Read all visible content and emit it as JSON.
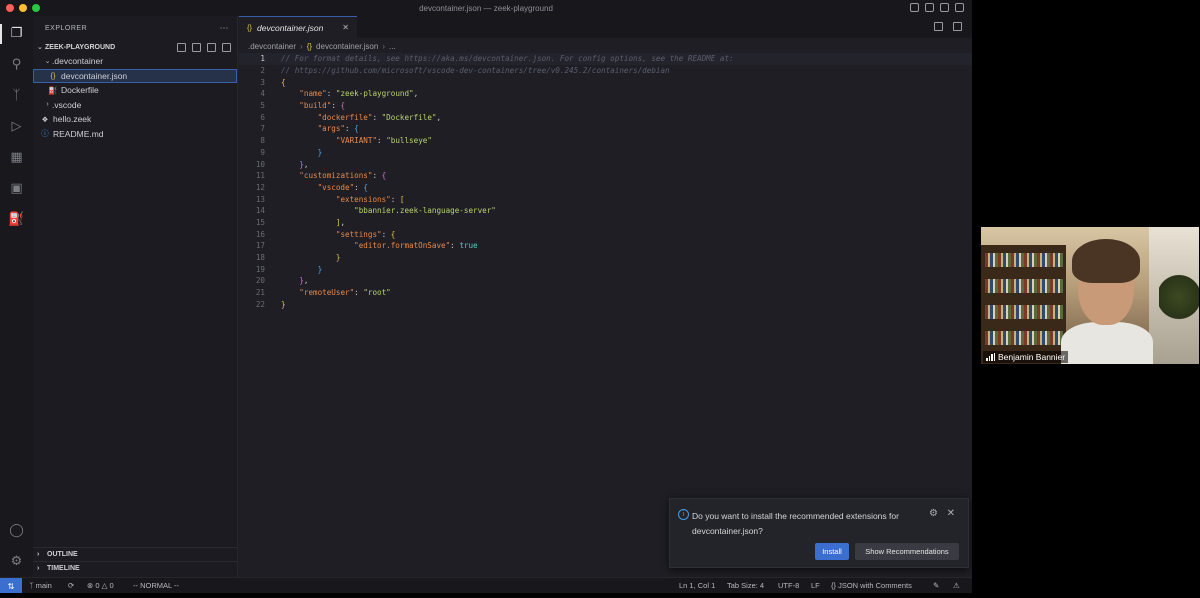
{
  "window": {
    "title": "devcontainer.json — zeek-playground"
  },
  "sidebar": {
    "header": "EXPLORER",
    "project": "ZEEK-PLAYGROUND",
    "tree": [
      {
        "label": ".devcontainer",
        "icon": "chevron-down"
      },
      {
        "label": "devcontainer.json",
        "icon": "json-braces-icon"
      },
      {
        "label": "Dockerfile",
        "icon": "docker-icon"
      },
      {
        "label": ".vscode",
        "icon": "chevron-right"
      },
      {
        "label": "hello.zeek",
        "icon": "zeek-icon"
      },
      {
        "label": "README.md",
        "icon": "info-icon"
      }
    ],
    "outline": "OUTLINE",
    "timeline": "TIMELINE"
  },
  "editor": {
    "tab": "devcontainer.json",
    "breadcrumb": [
      ".devcontainer",
      "devcontainer.json",
      "..."
    ],
    "lines": [
      "1",
      "2",
      "3",
      "4",
      "5",
      "6",
      "7",
      "8",
      "9",
      "10",
      "11",
      "12",
      "13",
      "14",
      "15",
      "16",
      "17",
      "18",
      "19",
      "20",
      "21",
      "22"
    ],
    "code": {
      "c1": "// For format details, see https://aka.ms/devcontainer.json. For config options, see the README at:",
      "c2": "// https://github.com/microsoft/vscode-dev-containers/tree/v0.245.2/containers/debian",
      "k_name": "\"name\"",
      "v_name": "\"zeek-playground\"",
      "k_build": "\"build\"",
      "k_dockerfile": "\"dockerfile\"",
      "v_dockerfile": "\"Dockerfile\"",
      "k_args": "\"args\"",
      "k_variant": "\"VARIANT\"",
      "v_variant": "\"bullseye\"",
      "k_custom": "\"customizations\"",
      "k_vscode": "\"vscode\"",
      "k_ext": "\"extensions\"",
      "v_ext": "\"bbannier.zeek-language-server\"",
      "k_settings": "\"settings\"",
      "k_fmt": "\"editor.formatOnSave\"",
      "v_fmt": "true",
      "k_remote": "\"remoteUser\"",
      "v_remote": "\"root\""
    }
  },
  "notification": {
    "message": "Do you want to install the recommended extensions for devcontainer.json?",
    "install": "Install",
    "show": "Show Recommendations"
  },
  "statusbar": {
    "branch": "main",
    "problems": "0",
    "warnings": "0",
    "mode": "-- NORMAL --",
    "position": "Ln 1, Col 1",
    "tabsize": "Tab Size: 4",
    "encoding": "UTF-8",
    "eol": "LF",
    "language": "JSON with Comments"
  },
  "video": {
    "name": "Benjamin Bannier"
  }
}
